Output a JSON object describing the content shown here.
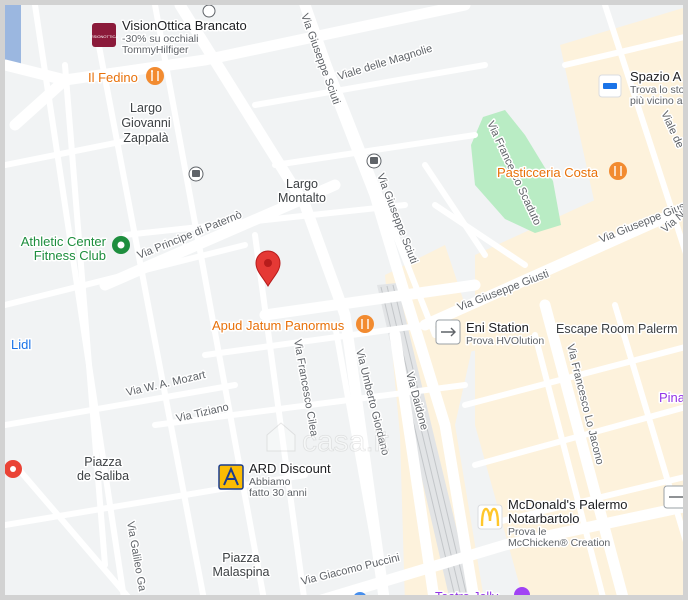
{
  "map": {
    "streets": [
      "Viale delle Magnolie",
      "Via Giuseppe Sciuti",
      "Via Giuseppe Sciuti",
      "Via Principe di Paternò",
      "Via Francesco Scaduto",
      "Via Giuseppe Giusti",
      "Via Giuseppe Giusti",
      "Via W. A. Mozart",
      "Via Tiziano",
      "Via Francesco Cilea",
      "Via Umberto Giordano",
      "Via Daidone",
      "Via Francesco Lo Jacono",
      "Via Giacomo Puccini",
      "Via Galileo Ga",
      "Viale de",
      "Via Nin"
    ],
    "places": {
      "largo_zappala": [
        "Largo",
        "Giovanni",
        "Zappalà"
      ],
      "largo_montalto": [
        "Largo",
        "Montalto"
      ],
      "piazza_saliba": [
        "Piazza",
        "de Saliba"
      ],
      "piazza_malaspina": [
        "Piazza",
        "Malaspina"
      ],
      "lidl": "Lidl",
      "pina": "Pina"
    },
    "pois": {
      "vision_title": "VisionOttica Brancato",
      "vision_sub1": "-30% su occhiali",
      "vision_sub2": "TommyHilfiger",
      "vision_logo": "VISIONOTTICA",
      "fedino": "Il Fedino",
      "spazio_title": "Spazio A",
      "spazio_sub1": "Trova lo sto",
      "spazio_sub2": "più vicino a",
      "pasticceria": "Pasticceria Costa",
      "athletic1": "Athletic Center",
      "athletic2": "Fitness Club",
      "apud": "Apud Jatum Panormus",
      "eni_title": "Eni Station",
      "eni_sub": "Prova HVOlution",
      "escape": "Escape Room Palerm",
      "ard_title": "ARD Discount",
      "ard_sub1": "Abbiamo",
      "ard_sub2": "fatto 30 anni",
      "mcd_title1": "McDonald's Palermo",
      "mcd_title2": "Notarbartolo",
      "mcd_sub1": "Prova le",
      "mcd_sub2": "McChicken® Creation",
      "teatro": "Teatro Jolly"
    },
    "watermark": "casa.it",
    "colors": {
      "background": "#f1f3f4",
      "road": "#ffffff",
      "block": "#fdf2dc",
      "park": "#b9ecc4",
      "pin": "#e53935",
      "food": "#f28b30",
      "green": "#1e8e3e",
      "ard": "#fbbc04",
      "mcd": "#ffc72c"
    }
  }
}
